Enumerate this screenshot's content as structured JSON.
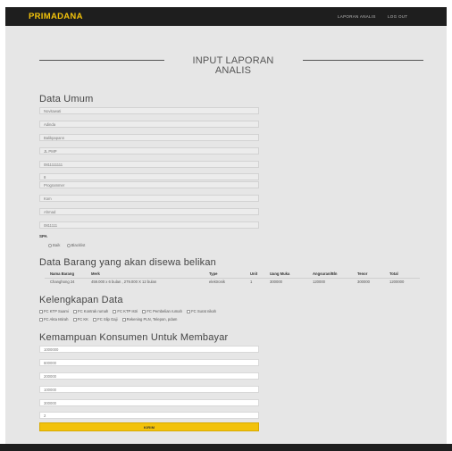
{
  "header": {
    "brand": "PRIMADANA",
    "nav": [
      "LAPORAN ANALIS",
      "LOG OUT"
    ]
  },
  "hero": {
    "title_line1": "INPUT LAPORAN",
    "title_line2": "ANALIS"
  },
  "data_umum": {
    "title": "Data Umum",
    "fields": [
      "Novitawati",
      "Adinda",
      "Balikpapann",
      "JL PMP",
      "0811111111",
      "8",
      "Programmer",
      "Kom",
      "Ahmad",
      "0811111"
    ],
    "spa_label": "SPA",
    "radio_options": [
      "Baik",
      "Blacklist"
    ]
  },
  "data_barang": {
    "title": "Data Barang yang akan disewa belikan",
    "columns": [
      "Nama Barang",
      "Merk",
      "Type",
      "Unit",
      "Uang Muka",
      "Angsuran/Bln",
      "Tenor",
      "Total"
    ],
    "rows": [
      [
        "Changhong 24",
        "459.000 x 6 bulan , 279.000 X 12 bulan",
        "elektronik",
        "1",
        "300000",
        "120000",
        "300000",
        "1200000"
      ]
    ]
  },
  "kelengkapan": {
    "title": "Kelengkapan Data",
    "row1": [
      "FC KTP Suami",
      "FC Kontrak rumah",
      "FC KTP Istri",
      "FC Pembelian rumah",
      "FC Surat nikah"
    ],
    "row2": [
      "FC Akta Istirah",
      "FC KK",
      "FC Slip Gaji",
      "Rekening PLN, Telepon, pdam"
    ]
  },
  "kemampuan": {
    "title": "Kemampuan Konsumen Untuk Membayar",
    "fields": [
      "1000000",
      "600000",
      "200000",
      "100000",
      "300000",
      "2"
    ],
    "submit_label": "KIRIM"
  }
}
